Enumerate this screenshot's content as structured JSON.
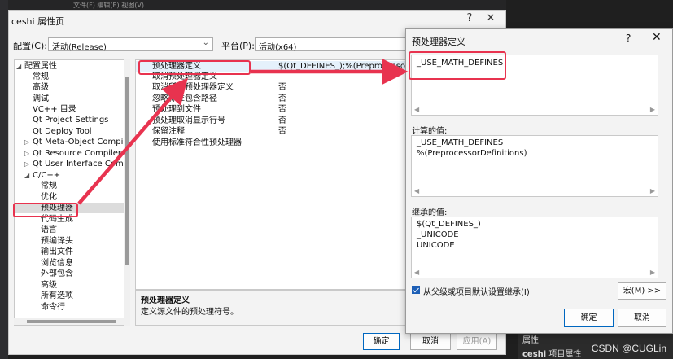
{
  "ide": {
    "top_text": "文件(F)  编辑(E)  视图(V)",
    "bottom_label1": "属性",
    "bottom_label2_bold": "ceshi",
    "bottom_label2_rest": " 项目属性",
    "watermark": "CSDN @CUGLin"
  },
  "property_pages": {
    "title": "ceshi 属性页",
    "help": "?",
    "close": "✕",
    "config_label": "配置(C):",
    "config_value": "活动(Release)",
    "platform_label": "平台(P):",
    "platform_value": "活动(x64)",
    "tree_items": [
      {
        "label": "配置属性",
        "arrow": "◢"
      },
      {
        "label": "常规",
        "arrow": ""
      },
      {
        "label": "高级",
        "arrow": ""
      },
      {
        "label": "调试",
        "arrow": ""
      },
      {
        "label": "VC++ 目录",
        "arrow": ""
      },
      {
        "label": "Qt Project Settings",
        "arrow": ""
      },
      {
        "label": "Qt Deploy Tool",
        "arrow": ""
      },
      {
        "label": "Qt Meta-Object Compil",
        "arrow": "▷"
      },
      {
        "label": "Qt Resource Compiler",
        "arrow": "▷"
      },
      {
        "label": "Qt User Interface Compi",
        "arrow": "▷"
      },
      {
        "label": "C/C++",
        "arrow": "◢"
      },
      {
        "label": "常规",
        "arrow": ""
      },
      {
        "label": "优化",
        "arrow": ""
      },
      {
        "label": "预处理器",
        "arrow": ""
      },
      {
        "label": "代码生成",
        "arrow": ""
      },
      {
        "label": "语言",
        "arrow": ""
      },
      {
        "label": "预编译头",
        "arrow": ""
      },
      {
        "label": "输出文件",
        "arrow": ""
      },
      {
        "label": "浏览信息",
        "arrow": ""
      },
      {
        "label": "外部包含",
        "arrow": ""
      },
      {
        "label": "高级",
        "arrow": ""
      },
      {
        "label": "所有选项",
        "arrow": ""
      },
      {
        "label": "命令行",
        "arrow": ""
      }
    ],
    "grid_rows": [
      {
        "name": "预处理器定义",
        "value": "$(Qt_DEFINES_);%(PreprocessorDef"
      },
      {
        "name": "取消预处理器定义",
        "value": ""
      },
      {
        "name": "取消所有预处理器定义",
        "value": "否"
      },
      {
        "name": "忽略标准包含路径",
        "value": "否"
      },
      {
        "name": "预处理到文件",
        "value": "否"
      },
      {
        "name": "预处理取消显示行号",
        "value": "否"
      },
      {
        "name": "保留注释",
        "value": "否"
      },
      {
        "name": "使用标准符合性预处理器",
        "value": ""
      }
    ],
    "desc_title": "预处理器定义",
    "desc_text": "定义源文件的预处理符号。",
    "ok": "确定",
    "cancel": "取消",
    "apply": "应用(A)"
  },
  "preproc_dialog": {
    "title": "预处理器定义",
    "help": "?",
    "close": "✕",
    "edit_value": "_USE_MATH_DEFINES",
    "computed_label": "计算的值:",
    "computed_lines": [
      "_USE_MATH_DEFINES",
      "%(PreprocessorDefinitions)"
    ],
    "inherited_label": "继承的值:",
    "inherited_lines": [
      "$(Qt_DEFINES_)",
      "_UNICODE",
      "UNICODE"
    ],
    "inherit_checkbox": "从父级或项目默认设置继承(I)",
    "inherit_checked": true,
    "macro_button": "宏(M) >>",
    "ok": "确定",
    "cancel": "取消",
    "scroll_left": "◀",
    "scroll_right": "▶"
  },
  "annotation": {
    "color": "#e8334f"
  }
}
